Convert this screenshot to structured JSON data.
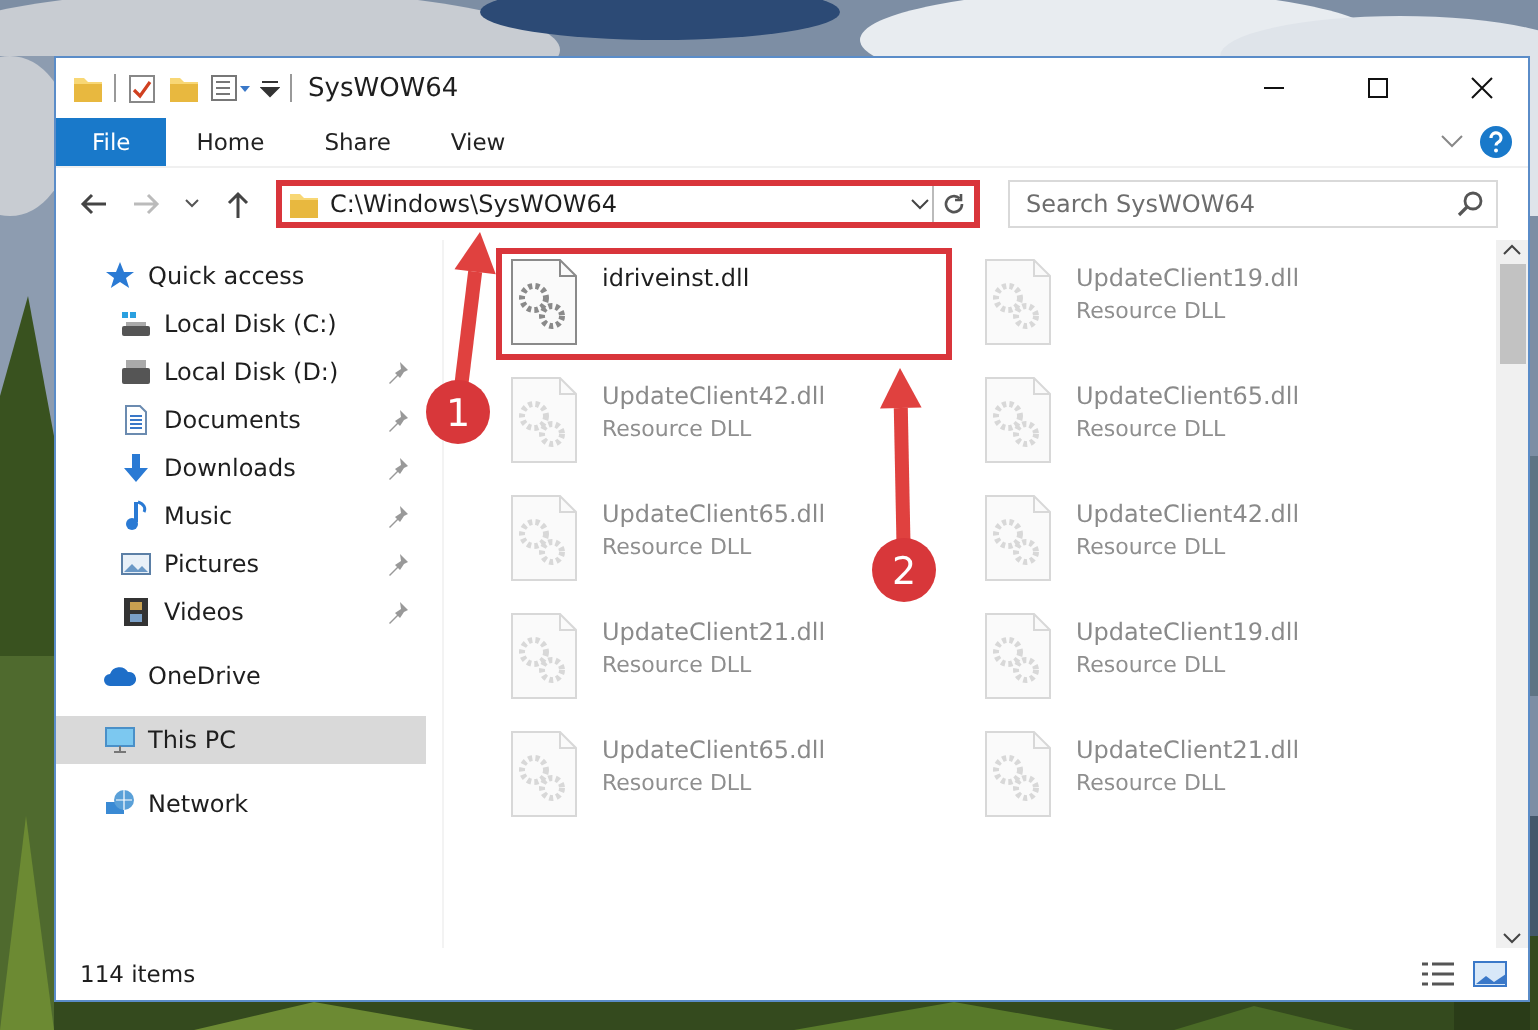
{
  "window": {
    "title": "SysWOW64"
  },
  "ribbon_tabs": [
    {
      "label": "File",
      "selected": true
    },
    {
      "label": "Home",
      "selected": false
    },
    {
      "label": "Share",
      "selected": false
    },
    {
      "label": "View",
      "selected": false
    }
  ],
  "address_bar": {
    "path": "C:\\Windows\\SysWOW64",
    "annotated": true
  },
  "search": {
    "placeholder": "Search SysWOW64"
  },
  "sidebar": {
    "items": [
      {
        "label": "Quick access",
        "kind": "star",
        "selected": false,
        "children": [
          {
            "label": "Local Disk (C:)",
            "kind": "drive-c",
            "pinned": false,
            "selected": false
          },
          {
            "label": "Local Disk (D:)",
            "kind": "drive",
            "pinned": true,
            "selected": false
          },
          {
            "label": "Documents",
            "kind": "documents",
            "pinned": true,
            "selected": false
          },
          {
            "label": "Downloads",
            "kind": "downloads",
            "pinned": true,
            "selected": false
          },
          {
            "label": "Music",
            "kind": "music",
            "pinned": true,
            "selected": false
          },
          {
            "label": "Pictures",
            "kind": "pictures",
            "pinned": true,
            "selected": false
          },
          {
            "label": "Videos",
            "kind": "videos",
            "pinned": true,
            "selected": false
          }
        ]
      },
      {
        "label": "OneDrive",
        "kind": "cloud",
        "selected": false
      },
      {
        "label": "This PC",
        "kind": "pc",
        "selected": true
      },
      {
        "label": "Network",
        "kind": "network",
        "selected": false
      }
    ]
  },
  "files": [
    {
      "name": "idriveinst.dll",
      "faded": false,
      "annotated": true
    },
    {
      "name": "UpdateClient19.dll",
      "type": "Resource DLL",
      "faded": true,
      "annotated": false
    },
    {
      "name": "UpdateClient42.dll",
      "type": "Resource DLL",
      "faded": true,
      "annotated": false
    },
    {
      "name": "UpdateClient65.dll",
      "type": "Resource DLL",
      "faded": true,
      "annotated": false
    },
    {
      "name": "UpdateClient65.dll",
      "type": "Resource DLL",
      "faded": true,
      "annotated": false
    },
    {
      "name": "UpdateClient42.dll",
      "type": "Resource DLL",
      "faded": true,
      "annotated": false
    },
    {
      "name": "UpdateClient21.dll",
      "type": "Resource DLL",
      "faded": true,
      "annotated": false
    },
    {
      "name": "UpdateClient19.dll",
      "type": "Resource DLL",
      "faded": true,
      "annotated": false
    },
    {
      "name": "UpdateClient65.dll",
      "type": "Resource DLL",
      "faded": true,
      "annotated": false
    },
    {
      "name": "UpdateClient21.dll",
      "type": "Resource DLL",
      "faded": true,
      "annotated": false
    }
  ],
  "status_bar": {
    "count": "114 items"
  },
  "annotations": [
    {
      "number": "1"
    },
    {
      "number": "2"
    }
  ]
}
